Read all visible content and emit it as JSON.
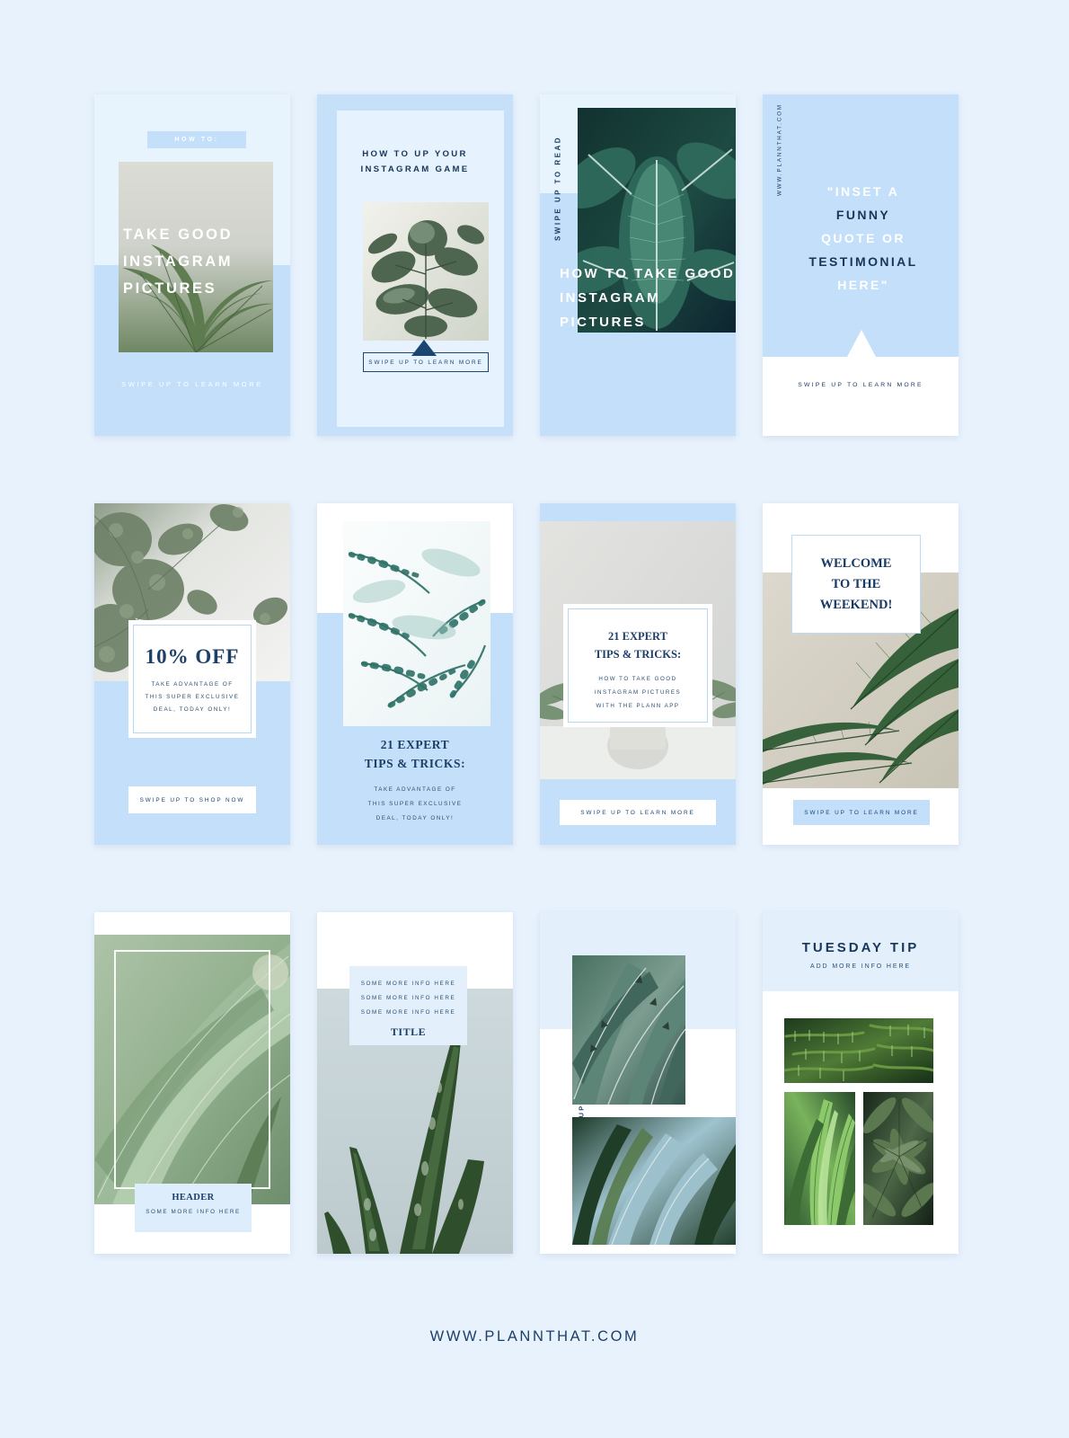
{
  "footer": {
    "url": "WWW.PLANNTHAT.COM"
  },
  "colors": {
    "page_bg": "#e8f2fd",
    "blue_light": "#e8f4fd",
    "blue_mid": "#c3dff9",
    "navy": "#1c3f68",
    "white": "#ffffff"
  },
  "cards": [
    {
      "id": "how-to-take-good-instagram-pictures",
      "chip": "HOW TO:",
      "headline": "TAKE GOOD INSTAGRAM PICTURES",
      "swipe": "SWIPE UP TO LEARN MORE"
    },
    {
      "id": "how-to-up-your-instagram-game",
      "title_line1": "HOW TO UP YOUR",
      "title_line2": "INSTAGRAM GAME",
      "button": "SWIPE UP TO LEARN MORE"
    },
    {
      "id": "swipe-up-to-read",
      "sidetext": "SWIPE UP TO READ",
      "headline": "HOW TO TAKE GOOD INSTAGRAM PICTURES"
    },
    {
      "id": "funny-quote-testimonial",
      "sidetext": "WWW.PLANNTHAT.COM",
      "quote_line1": "\"INSET A",
      "quote_line2": "FUNNY",
      "quote_line3": "QUOTE OR",
      "quote_line4": "TESTIMONIAL",
      "quote_line5": "HERE\"",
      "swipe": "SWIPE UP TO LEARN MORE"
    },
    {
      "id": "ten-percent-off",
      "percent": "10% OFF",
      "desc_line1": "TAKE ADVANTAGE OF",
      "desc_line2": "THIS SUPER EXCLUSIVE",
      "desc_line3": "DEAL, TODAY ONLY!",
      "button": "SWIPE UP TO SHOP NOW"
    },
    {
      "id": "21-expert-tips-tricks",
      "title_line1": "21 EXPERT",
      "title_line2": "TIPS & TRICKS:",
      "desc_line1": "TAKE ADVANTAGE OF",
      "desc_line2": "THIS SUPER EXCLUSIVE",
      "desc_line3": "DEAL, TODAY ONLY!"
    },
    {
      "id": "21-expert-tips-plann-app",
      "title_line1": "21 EXPERT",
      "title_line2": "TIPS & TRICKS:",
      "desc_line1": "HOW TO TAKE GOOD",
      "desc_line2": "INSTAGRAM PICTURES",
      "desc_line3": "WITH THE PLANN APP",
      "button": "SWIPE UP TO LEARN MORE"
    },
    {
      "id": "welcome-to-the-weekend",
      "title_line1": "WELCOME",
      "title_line2": "TO THE",
      "title_line3": "WEEKEND!",
      "button": "SWIPE UP TO LEARN MORE"
    },
    {
      "id": "header-some-more-info",
      "header": "HEADER",
      "sub": "SOME MORE INFO HERE"
    },
    {
      "id": "title-some-more-info",
      "line1": "SOME MORE INFO HERE",
      "line2": "SOME MORE INFO HERE",
      "line3": "SOME MORE INFO HERE",
      "title": "TITLE"
    },
    {
      "id": "swipe-up-to-read-full-blog",
      "sidetext": "SWIPE UP TO READ FULL BLOG"
    },
    {
      "id": "tuesday-tip",
      "title": "TUESDAY TIP",
      "sub": "ADD MORE INFO HERE"
    }
  ]
}
